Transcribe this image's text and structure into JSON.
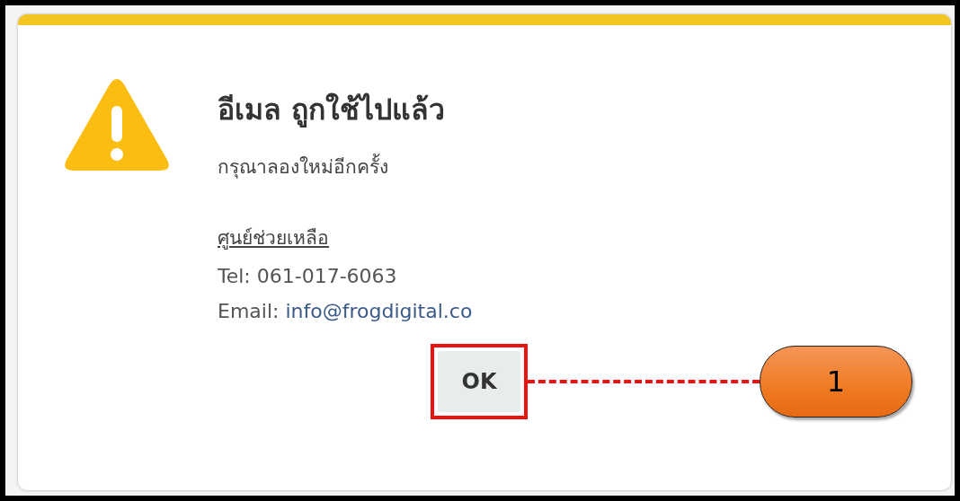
{
  "dialog": {
    "title": "อีเมล ถูกใช้ไปแล้ว",
    "message": "กรุณาลองใหม่อีกครั้ง",
    "help_heading": "ศูนย์ช่วยเหลือ",
    "tel": "Tel: 061-017-6063",
    "email_label": "Email:",
    "email_link": "info@frogdigital.co",
    "button": "OK"
  },
  "annotation": {
    "label": "1"
  }
}
